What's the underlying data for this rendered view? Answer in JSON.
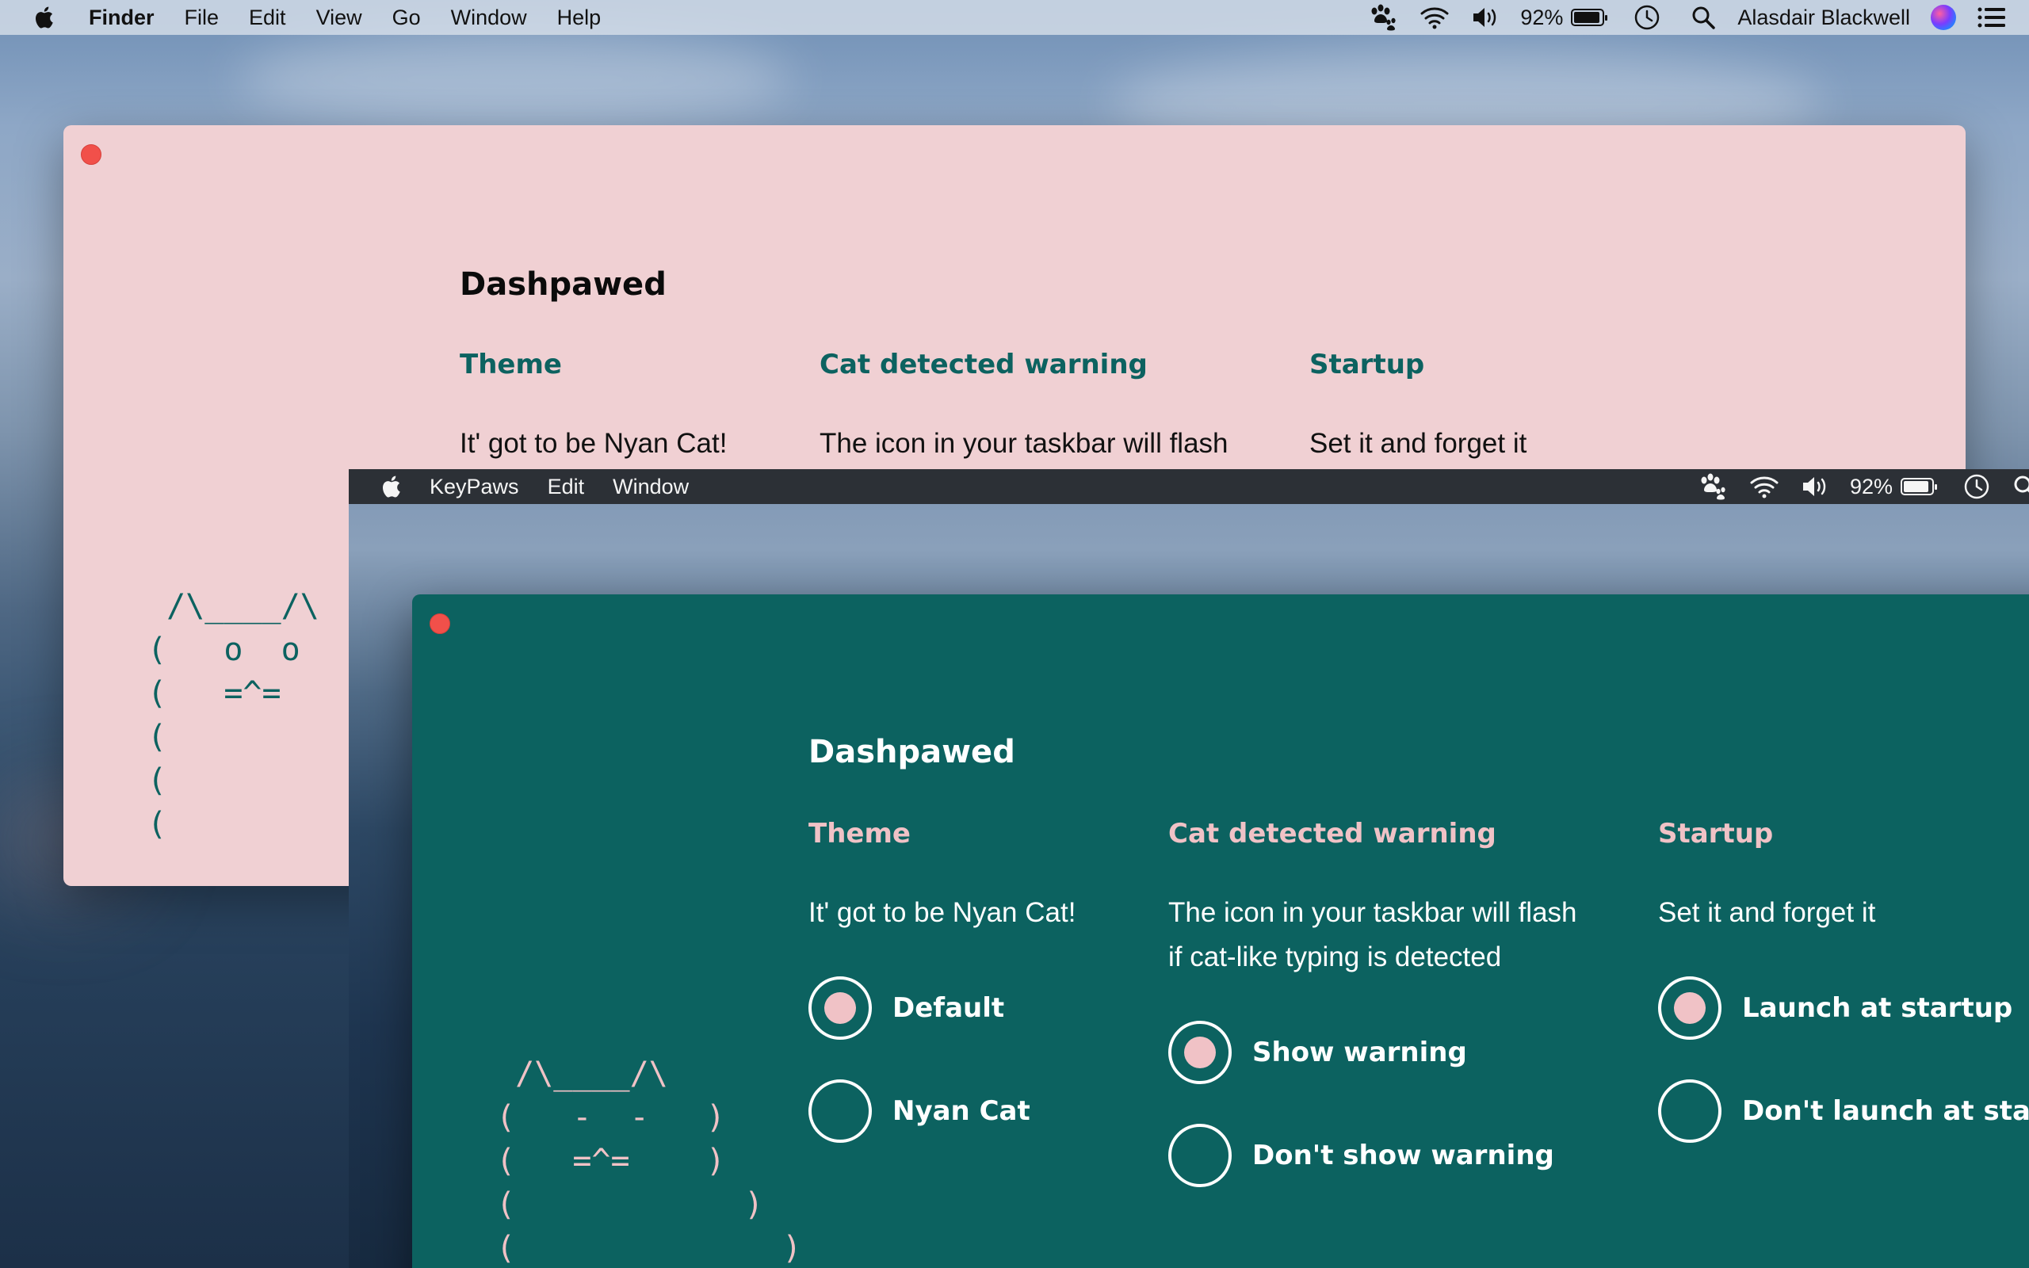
{
  "finder_menubar": {
    "app": "Finder",
    "items": [
      "File",
      "Edit",
      "View",
      "Go",
      "Window",
      "Help"
    ],
    "battery": "92%",
    "user": "Alasdair Blackwell"
  },
  "keypaws_menubar": {
    "app": "KeyPaws",
    "items": [
      "Edit",
      "Window"
    ],
    "battery": "92%"
  },
  "battery_level": 0.92,
  "app_title": "Dashpawed",
  "theme": {
    "heading": "Theme",
    "description": "It' got to be Nyan Cat!",
    "options": [
      "Default",
      "Nyan Cat"
    ],
    "selected": "Default"
  },
  "warning": {
    "heading": "Cat detected warning",
    "description_line1": "The icon in your taskbar will flash",
    "description_line2": "if cat-like typing is detected",
    "options": [
      "Show warning",
      "Don't show warning"
    ],
    "selected": "Show warning"
  },
  "startup": {
    "heading": "Startup",
    "description": "Set it and forget it",
    "options": [
      "Launch at startup",
      "Don't launch at startup"
    ],
    "selected": "Launch at startup"
  },
  "cat_pink": {
    "l1": " /\\____/\\",
    "l2": "(   o  o   )",
    "l3": "(   =^=    )",
    "l4": "(            )",
    "l5": "(              )",
    "l6": "("
  },
  "cat_teal": {
    "l1": " /\\____/\\",
    "l2": "(   -  -   )",
    "l3": "(   =^=    )",
    "l4": "(            )",
    "l5": "(              )"
  },
  "colors": {
    "pink_bg": "#f0d0d3",
    "teal_bg": "#0c6260",
    "accent_pink": "#f0c2c6",
    "close_red": "#f1504a"
  },
  "icons": [
    "apple-icon",
    "paw-icon",
    "wifi-icon",
    "volume-icon",
    "battery-icon",
    "clock-icon",
    "search-icon",
    "siri-icon",
    "control-center-icon"
  ]
}
